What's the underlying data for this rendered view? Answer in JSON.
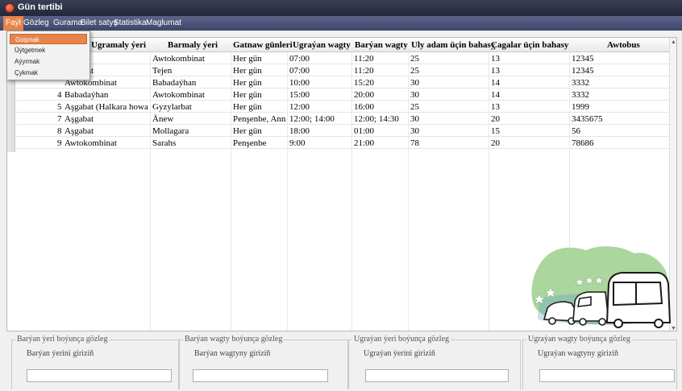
{
  "window": {
    "title": "Gün tertibi"
  },
  "menu": {
    "items": [
      "Faýl",
      "Gözleg",
      "Gurama",
      "Bilet satyş",
      "Statistika",
      "Maglumat"
    ],
    "active_index": 0,
    "dropdown": [
      "Goşmak",
      "Üýtgetmek",
      "Aýyrmak",
      "Çykmak"
    ],
    "dropdown_highlight": 0
  },
  "table": {
    "columns": [
      "Ugramaly ýeri",
      "Barmaly ýeri",
      "Gatnaw günleri",
      "Ugraýan wagty",
      "Barýan wagty",
      "Uly adam üçin bahasy",
      "Çagalar üçin bahasy",
      "Awtobus"
    ],
    "rows": [
      {
        "id": "",
        "from": "",
        "to": "Awtokombinat",
        "days": "Her gün",
        "dep": "07:00",
        "arr": "11:20",
        "adult": "25",
        "child": "13",
        "bus": "12345"
      },
      {
        "id": "",
        "from": "ombinat",
        "to": "Tejen",
        "days": "Her gün",
        "dep": "07:00",
        "arr": "11:20",
        "adult": "25",
        "child": "13",
        "bus": "12345"
      },
      {
        "id": "",
        "from": "Awtokombinat",
        "to": "Babadaýhan",
        "days": "Her gün",
        "dep": "10:00",
        "arr": "15:20",
        "adult": "30",
        "child": "14",
        "bus": "3332"
      },
      {
        "id": "4",
        "from": "Babadaýhan",
        "to": "Awtokombinat",
        "days": "Her gün",
        "dep": "15:00",
        "arr": "20:00",
        "adult": "30",
        "child": "14",
        "bus": "3332"
      },
      {
        "id": "5",
        "from": "Aşgabat (Halkara howa me",
        "to": "Gyzylarbat",
        "days": "Her gün",
        "dep": "12:00",
        "arr": "16:00",
        "adult": "25",
        "child": "13",
        "bus": "1999"
      },
      {
        "id": "7",
        "from": "Aşgabat",
        "to": "Änew",
        "days": "Penşenbe, Anna,",
        "dep": "12:00; 14:00",
        "arr": "12:00; 14:30",
        "adult": "30",
        "child": "20",
        "bus": "3435675"
      },
      {
        "id": "8",
        "from": "Aşgabat",
        "to": "Mollagara",
        "days": "Her gün",
        "dep": "18:00",
        "arr": "01:00",
        "adult": "30",
        "child": "15",
        "bus": "56"
      },
      {
        "id": "9",
        "from": "Awtokombinat",
        "to": "Sarahs",
        "days": "Penşenbe",
        "dep": "9:00",
        "arr": "21:00",
        "adult": "78",
        "child": "20",
        "bus": "78686"
      }
    ]
  },
  "filters": [
    {
      "legend": "Barýan ýeri boýunça gözleg",
      "label": "Barýan ýerini giriziň",
      "value": ""
    },
    {
      "legend": "Barýan wagty boýunça gözleg",
      "label": "Barýan wagtyny giriziň",
      "value": ""
    },
    {
      "legend": "Ugraýan ýeri boýunça gözleg",
      "label": "Ugraýan ýerini giriziň",
      "value": ""
    },
    {
      "legend": "Ugraýan wagty boýunça gözleg",
      "label": "Ugraýan wagtyny giriziň",
      "value": ""
    }
  ],
  "colors": {
    "menu_active": "#e8834a",
    "title_bar": "#2a2f45",
    "map_green": "#9ccf8c",
    "stars": "#ffffff"
  },
  "icons": {
    "app": "app-icon",
    "logo": "bus-logo"
  }
}
